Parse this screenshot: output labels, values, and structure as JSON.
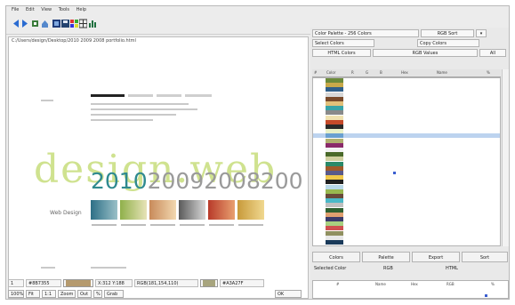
{
  "menu": [
    "File",
    "Edit",
    "View",
    "Tools",
    "Help"
  ],
  "toolbar": {
    "buttons": [
      "back",
      "forward",
      "refresh",
      "home",
      "open",
      "save",
      "palette",
      "grid",
      "chart"
    ]
  },
  "preview": {
    "path": "C:/Users/design/Desktop/2010 2009 2008 portfolio.html",
    "watermark": "design.web",
    "year_2010": "2010",
    "year_rest": "20092008200",
    "side_label": "Web Design"
  },
  "status_bar": {
    "swatch_1_label": "#8B7355",
    "swatch_1_color": "#b59a6e",
    "swatch_2_label": "#A3A27F",
    "swatch_2_color": "#a8a57e",
    "pos_label": "X:312 Y:188",
    "info_label": "RGB(181,154,110)",
    "count": "1"
  },
  "bottom_controls": {
    "zoom": "100%",
    "fit": "Fit",
    "actual": "1:1",
    "zoom_in": "Zoom",
    "zoom_out": "Out",
    "percent": "%",
    "grab": "Grab",
    "ok": "OK"
  },
  "right_panel": {
    "mode_label": "Color Palette - 256 Colors",
    "dropdown_value": "RGB Sort",
    "tools_label": "Select Colors",
    "copy_label": "Copy Colors",
    "tab_a": "HTML Colors",
    "tab_b": "RGB Values",
    "tab_c": "All",
    "columns": [
      "#",
      "Color",
      "R",
      "G",
      "B",
      "Hex",
      "Name",
      "%"
    ],
    "rows": [
      {
        "color": "#6b8a3a"
      },
      {
        "color": "#c8a94a"
      },
      {
        "color": "#2f5f8a"
      },
      {
        "color": "#d8d8d8"
      },
      {
        "color": "#7a4a2a"
      },
      {
        "color": "#e2c07a"
      },
      {
        "color": "#39a4a8"
      },
      {
        "color": "#8a8a8a"
      },
      {
        "color": "#f0e2b0"
      },
      {
        "color": "#c54a2a"
      },
      {
        "color": "#2a2a2a"
      },
      {
        "color": "#e8f0c8"
      },
      {
        "color": "#6aa0d0"
      },
      {
        "color": "#b0b070"
      },
      {
        "color": "#8a2a6a"
      },
      {
        "color": "#f2f2f2"
      },
      {
        "color": "#4a6a2a"
      },
      {
        "color": "#d0d0a0"
      },
      {
        "color": "#2a8a6a"
      },
      {
        "color": "#a05a2a"
      },
      {
        "color": "#5a5a8a"
      },
      {
        "color": "#f0c84a"
      },
      {
        "color": "#202020"
      },
      {
        "color": "#b8d8e8"
      },
      {
        "color": "#98b850"
      },
      {
        "color": "#6a4a3a"
      },
      {
        "color": "#4ab8c8"
      },
      {
        "color": "#c0c0c0"
      },
      {
        "color": "#306030"
      },
      {
        "color": "#e0a070"
      },
      {
        "color": "#3a3a6a"
      },
      {
        "color": "#a8d080"
      },
      {
        "color": "#d05050"
      },
      {
        "color": "#909060"
      },
      {
        "color": "#e8e8e8"
      },
      {
        "color": "#1a3a5a"
      }
    ],
    "tab_row": [
      "Colors",
      "Palette",
      "Export",
      "Sort"
    ],
    "bottom_left": "Selected Color",
    "bottom_mid": "RGB",
    "bottom_right": "HTML",
    "table2_cols": [
      "#",
      "Name",
      "Hex",
      "RGB",
      "%"
    ]
  }
}
